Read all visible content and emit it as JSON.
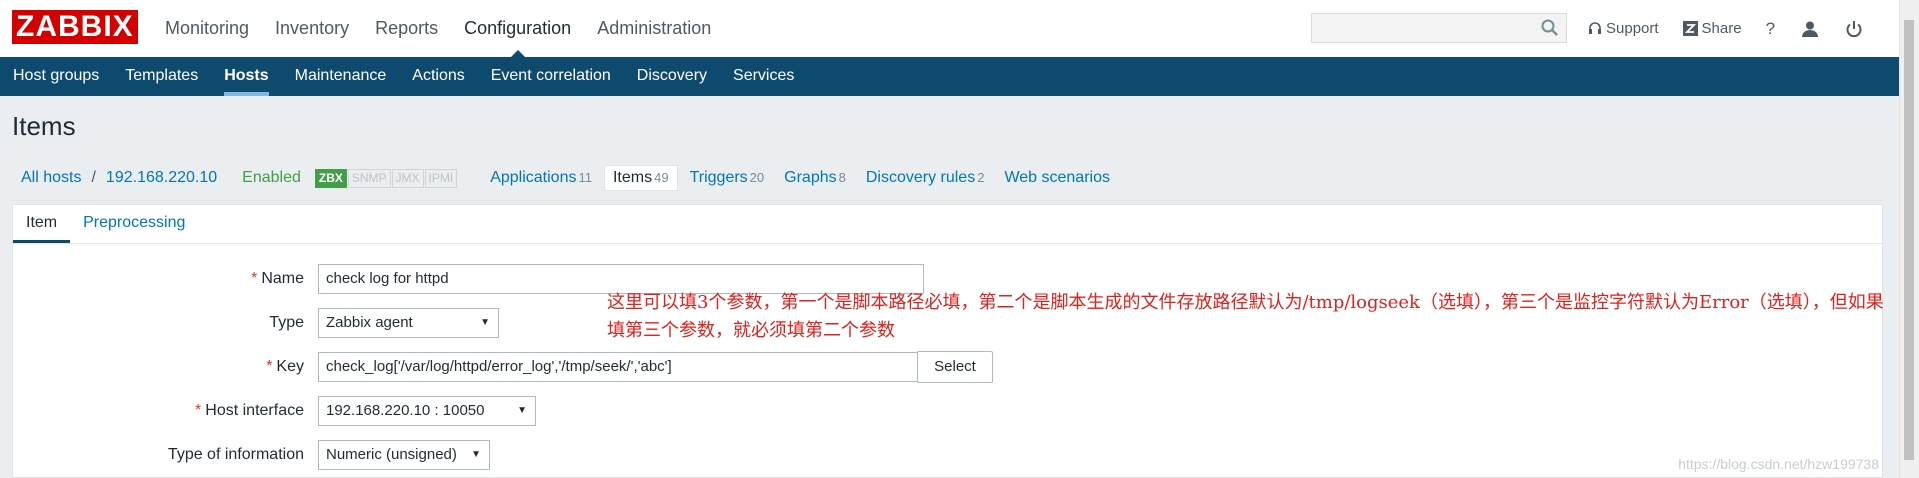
{
  "logo": "ZABBIX",
  "main_menu": [
    "Monitoring",
    "Inventory",
    "Reports",
    "Configuration",
    "Administration"
  ],
  "main_menu_active": "Configuration",
  "top_links": {
    "support": "Support",
    "share": "Share",
    "help": "?"
  },
  "sub_menu": [
    "Host groups",
    "Templates",
    "Hosts",
    "Maintenance",
    "Actions",
    "Event correlation",
    "Discovery",
    "Services"
  ],
  "page_title": "Items",
  "breadcrumb": {
    "all_hosts": "All hosts",
    "separator": "/",
    "host": "192.168.220.10",
    "status": "Enabled",
    "availability": [
      "ZBX",
      "SNMP",
      "JMX",
      "IPMI"
    ],
    "tabs": [
      {
        "label": "Applications",
        "count": "11"
      },
      {
        "label": "Items",
        "count": "49"
      },
      {
        "label": "Triggers",
        "count": "20"
      },
      {
        "label": "Graphs",
        "count": "8"
      },
      {
        "label": "Discovery rules",
        "count": "2"
      },
      {
        "label": "Web scenarios",
        "count": ""
      }
    ]
  },
  "form_tabs": [
    "Item",
    "Preprocessing"
  ],
  "form": {
    "name_label": "Name",
    "name_value": "check log for httpd",
    "type_label": "Type",
    "type_value": "Zabbix agent",
    "key_label": "Key",
    "key_value": "check_log['/var/log/httpd/error_log','/tmp/seek/','abc']",
    "select_button": "Select",
    "host_interface_label": "Host interface",
    "host_interface_value": "192.168.220.10 : 10050",
    "type_info_label": "Type of information",
    "type_info_value": "Numeric (unsigned)",
    "required_mark": "*"
  },
  "annotation": "这里可以填3个参数，第一个是脚本路径必填，第二个是脚本生成的文件存放路径默认为/tmp/logseek（选填），第三个是监控字符默认为Error（选填），但如果填第三个参数，就必须填第二个参数",
  "watermark": "https://blog.csdn.net/hzw199738",
  "colors": {
    "brand": "#d40000",
    "nav": "#0e4a6e",
    "link": "#0275b8",
    "enabled": "#429e47",
    "required": "#e33734",
    "annotation": "#e0201b"
  }
}
